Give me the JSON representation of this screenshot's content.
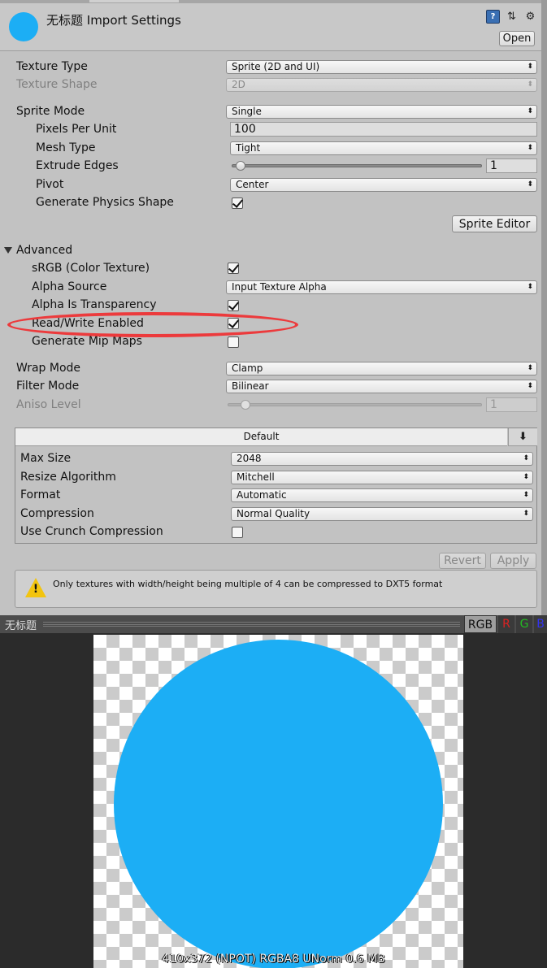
{
  "header": {
    "title": "无标题 Import Settings",
    "open_button": "Open",
    "icons": [
      "help-book-icon",
      "settings-sliders-icon",
      "gear-icon"
    ]
  },
  "texture": {
    "texture_type": {
      "label": "Texture Type",
      "value": "Sprite (2D and UI)"
    },
    "texture_shape": {
      "label": "Texture Shape",
      "value": "2D",
      "disabled": true
    },
    "sprite_mode": {
      "label": "Sprite Mode",
      "value": "Single"
    },
    "pixels_per_unit": {
      "label": "Pixels Per Unit",
      "value": "100"
    },
    "mesh_type": {
      "label": "Mesh Type",
      "value": "Tight"
    },
    "extrude_edges": {
      "label": "Extrude Edges",
      "value": "1",
      "slider_fraction": 0.0
    },
    "pivot": {
      "label": "Pivot",
      "value": "Center"
    },
    "generate_physics_shape": {
      "label": "Generate Physics Shape",
      "checked": true
    },
    "sprite_editor_button": "Sprite Editor"
  },
  "advanced": {
    "title": "Advanced",
    "srgb": {
      "label": "sRGB (Color Texture)",
      "checked": true
    },
    "alpha_source": {
      "label": "Alpha Source",
      "value": "Input Texture Alpha"
    },
    "alpha_is_transparency": {
      "label": "Alpha Is Transparency",
      "checked": true
    },
    "read_write_enabled": {
      "label": "Read/Write Enabled",
      "checked": true,
      "highlighted": true
    },
    "generate_mip_maps": {
      "label": "Generate Mip Maps",
      "checked": false
    }
  },
  "sampling": {
    "wrap_mode": {
      "label": "Wrap Mode",
      "value": "Clamp"
    },
    "filter_mode": {
      "label": "Filter Mode",
      "value": "Bilinear"
    },
    "aniso_level": {
      "label": "Aniso Level",
      "value": "1",
      "disabled": true
    }
  },
  "platform": {
    "tab": "Default",
    "max_size": {
      "label": "Max Size",
      "value": "2048"
    },
    "resize_algorithm": {
      "label": "Resize Algorithm",
      "value": "Mitchell"
    },
    "format": {
      "label": "Format",
      "value": "Automatic"
    },
    "compression": {
      "label": "Compression",
      "value": "Normal Quality"
    },
    "crunch": {
      "label": "Use Crunch Compression",
      "checked": false
    }
  },
  "actions": {
    "revert": "Revert",
    "apply": "Apply"
  },
  "help": {
    "message": "Only textures with width/height being multiple of 4 can be compressed to DXT5 format"
  },
  "preview": {
    "name": "无标题",
    "channels": [
      "RGB",
      "R",
      "G",
      "B"
    ],
    "info": "410x372 (NPOT)  RGBA8 UNorm   0.6 MB",
    "sprite_color": "#1caef5"
  },
  "colors": {
    "accent_highlight": "#ec3a3c",
    "sprite": "#1caef5"
  }
}
